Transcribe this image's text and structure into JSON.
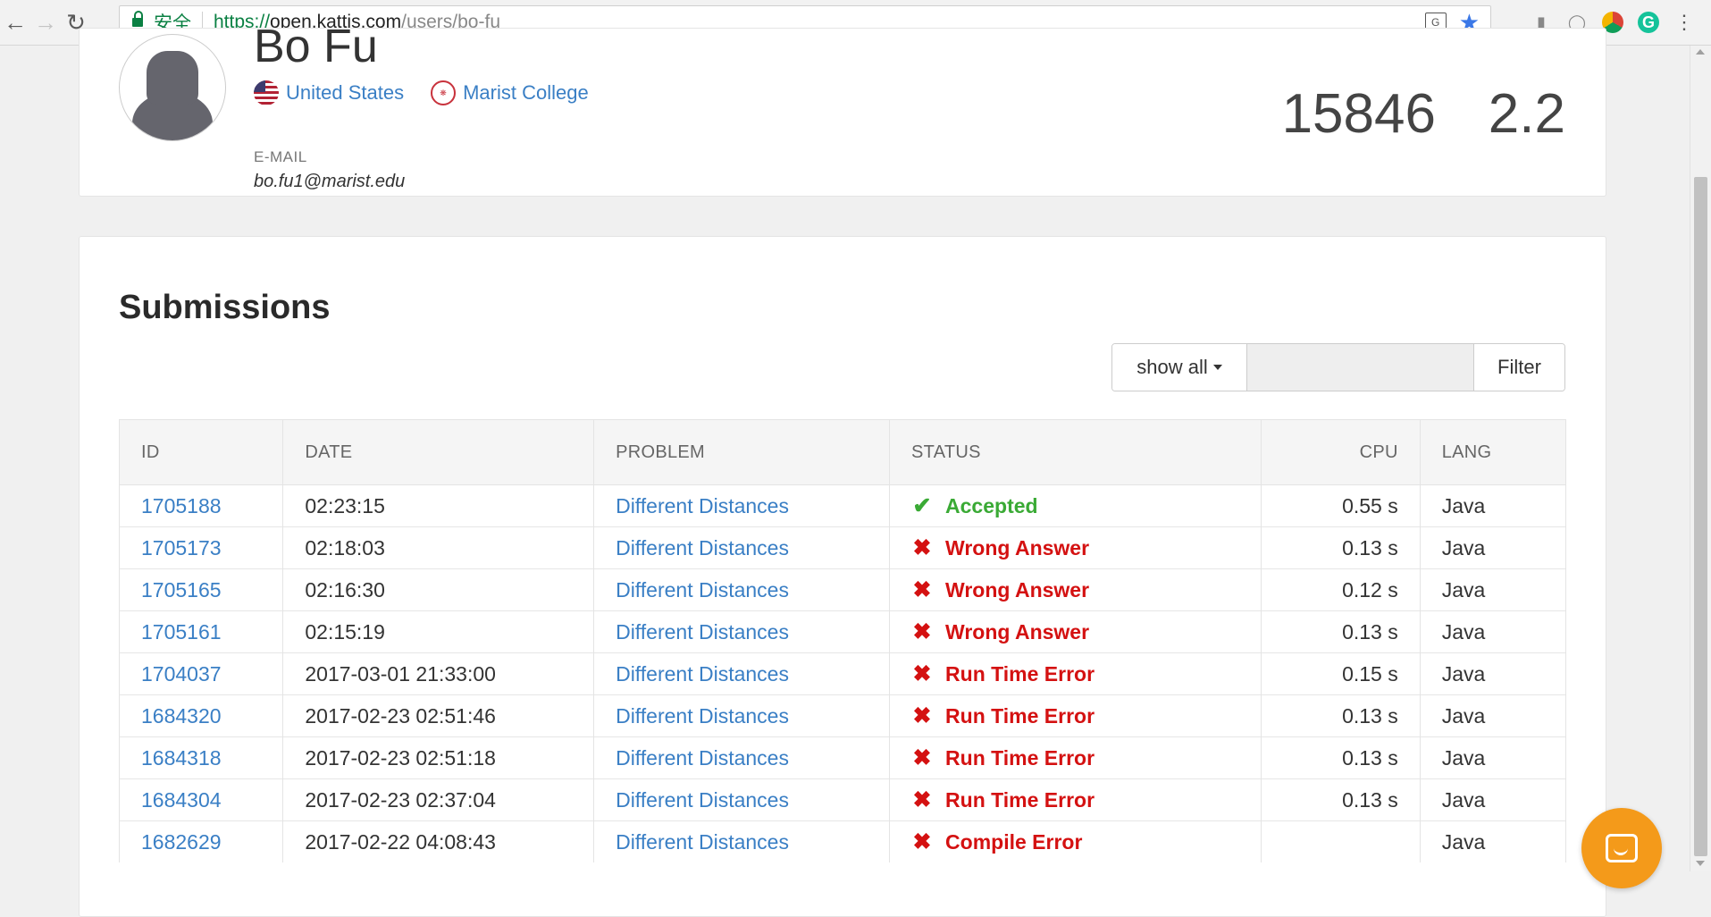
{
  "browser": {
    "secure_label": "安全",
    "url_scheme": "https://",
    "url_host": "open.kattis.com",
    "url_path": "/users/bo-fu"
  },
  "profile": {
    "name": "Bo Fu",
    "country": "United States",
    "school": "Marist College",
    "email_label": "E-MAIL",
    "email": "bo.fu1@marist.edu",
    "score": "15846",
    "rank": "2.2"
  },
  "submissions": {
    "title": "Submissions",
    "filter_dropdown": "show all",
    "filter_input_value": "",
    "filter_button": "Filter",
    "headers": [
      "ID",
      "DATE",
      "PROBLEM",
      "STATUS",
      "CPU",
      "LANG"
    ],
    "rows": [
      {
        "id": "1705188",
        "date": "02:23:15",
        "problem": "Different Distances",
        "status": "Accepted",
        "cpu": "0.55 s",
        "lang": "Java"
      },
      {
        "id": "1705173",
        "date": "02:18:03",
        "problem": "Different Distances",
        "status": "Wrong Answer",
        "cpu": "0.13 s",
        "lang": "Java"
      },
      {
        "id": "1705165",
        "date": "02:16:30",
        "problem": "Different Distances",
        "status": "Wrong Answer",
        "cpu": "0.12 s",
        "lang": "Java"
      },
      {
        "id": "1705161",
        "date": "02:15:19",
        "problem": "Different Distances",
        "status": "Wrong Answer",
        "cpu": "0.13 s",
        "lang": "Java"
      },
      {
        "id": "1704037",
        "date": "2017-03-01 21:33:00",
        "problem": "Different Distances",
        "status": "Run Time Error",
        "cpu": "0.15 s",
        "lang": "Java"
      },
      {
        "id": "1684320",
        "date": "2017-02-23 02:51:46",
        "problem": "Different Distances",
        "status": "Run Time Error",
        "cpu": "0.13 s",
        "lang": "Java"
      },
      {
        "id": "1684318",
        "date": "2017-02-23 02:51:18",
        "problem": "Different Distances",
        "status": "Run Time Error",
        "cpu": "0.13 s",
        "lang": "Java"
      },
      {
        "id": "1684304",
        "date": "2017-02-23 02:37:04",
        "problem": "Different Distances",
        "status": "Run Time Error",
        "cpu": "0.13 s",
        "lang": "Java"
      },
      {
        "id": "1682629",
        "date": "2017-02-22 04:08:43",
        "problem": "Different Distances",
        "status": "Compile Error",
        "cpu": "",
        "lang": "Java"
      }
    ]
  },
  "colors": {
    "link": "#3a7fc5",
    "accepted": "#3aaa35",
    "error": "#d41111",
    "chat": "#f49a1a"
  }
}
